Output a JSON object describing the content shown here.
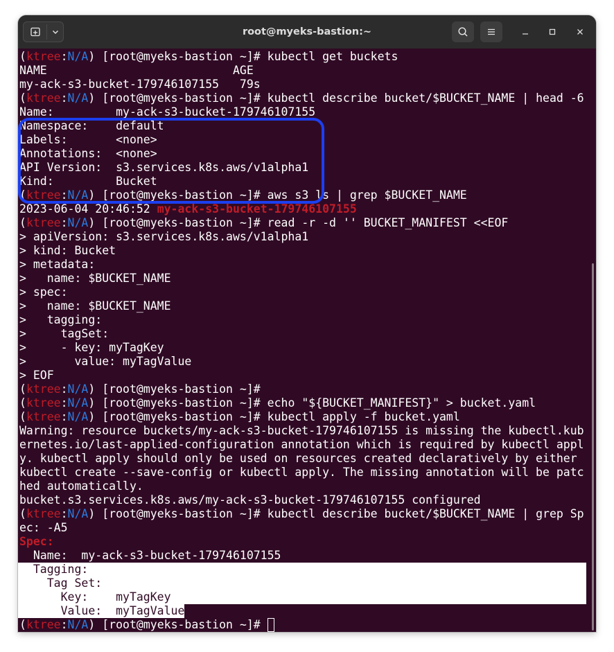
{
  "window": {
    "title": "root@myeks-bastion:~",
    "buttons": {
      "new_tab_icon": "new-tab-icon",
      "dropdown_icon": "chevron-down-icon",
      "search_icon": "search-icon",
      "menu_icon": "hamburger-menu-icon",
      "minimize_icon": "minimize-icon",
      "maximize_icon": "maximize-icon",
      "close_icon": "close-icon"
    }
  },
  "prompt": {
    "open": "(",
    "env": "ktree",
    "sep": ":",
    "ns": "N/A",
    "close": ")",
    "rest": " [root@myeks-bastion ~]# "
  },
  "colors": {
    "background": "#300a24",
    "foreground": "#ffffff",
    "prompt_env": "#c01c28",
    "prompt_ns": "#2a7bde",
    "highlight_box": "#1c3ff0"
  },
  "lines": [
    {
      "type": "prompt",
      "cmd": "kubectl get buckets"
    },
    {
      "type": "text",
      "text": "NAME                           AGE"
    },
    {
      "type": "text",
      "text": "my-ack-s3-bucket-179746107155   79s"
    },
    {
      "type": "prompt",
      "cmd": "kubectl describe bucket/$BUCKET_NAME | head -6"
    },
    {
      "type": "text",
      "text": "Name:         my-ack-s3-bucket-179746107155"
    },
    {
      "type": "text",
      "text": "Namespace:    default"
    },
    {
      "type": "text",
      "text": "Labels:       <none>"
    },
    {
      "type": "text",
      "text": "Annotations:  <none>"
    },
    {
      "type": "text",
      "text": "API Version:  s3.services.k8s.aws/v1alpha1"
    },
    {
      "type": "text",
      "text": "Kind:         Bucket"
    },
    {
      "type": "prompt",
      "cmd": "aws s3 ls | grep $BUCKET_NAME"
    },
    {
      "type": "grep",
      "text": "2023-06-04 20:46:52 ",
      "match": "my-ack-s3-bucket-179746107155"
    },
    {
      "type": "prompt",
      "cmd": "read -r -d '' BUCKET_MANIFEST <<EOF"
    },
    {
      "type": "text",
      "text": "> apiVersion: s3.services.k8s.aws/v1alpha1"
    },
    {
      "type": "text",
      "text": "> kind: Bucket"
    },
    {
      "type": "text",
      "text": "> metadata:"
    },
    {
      "type": "text",
      "text": ">   name: $BUCKET_NAME"
    },
    {
      "type": "text",
      "text": "> spec:"
    },
    {
      "type": "text",
      "text": ">   name: $BUCKET_NAME"
    },
    {
      "type": "text",
      "text": ">   tagging:"
    },
    {
      "type": "text",
      "text": ">     tagSet:"
    },
    {
      "type": "text",
      "text": ">     - key: myTagKey"
    },
    {
      "type": "text",
      "text": ">       value: myTagValue"
    },
    {
      "type": "text",
      "text": "> EOF"
    },
    {
      "type": "prompt",
      "cmd": ""
    },
    {
      "type": "prompt",
      "cmd": "echo \"${BUCKET_MANIFEST}\" > bucket.yaml"
    },
    {
      "type": "prompt",
      "cmd": "kubectl apply -f bucket.yaml"
    },
    {
      "type": "text",
      "text": "Warning: resource buckets/my-ack-s3-bucket-179746107155 is missing the kubectl.kub"
    },
    {
      "type": "text",
      "text": "ernetes.io/last-applied-configuration annotation which is required by kubectl appl"
    },
    {
      "type": "text",
      "text": "y. kubectl apply should only be used on resources created declaratively by either"
    },
    {
      "type": "text",
      "text": "kubectl create --save-config or kubectl apply. The missing annotation will be patc"
    },
    {
      "type": "text",
      "text": "hed automatically."
    },
    {
      "type": "text",
      "text": "bucket.s3.services.k8s.aws/my-ack-s3-bucket-179746107155 configured"
    },
    {
      "type": "prompt",
      "cmd": "kubectl describe bucket/$BUCKET_NAME | grep Sp"
    },
    {
      "type": "text",
      "text": "ec: -A5"
    },
    {
      "type": "bold_red",
      "text": "Spec:"
    },
    {
      "type": "text",
      "text": "  Name:  my-ack-s3-bucket-179746107155"
    },
    {
      "type": "selected",
      "text": "  Tagging:"
    },
    {
      "type": "selected",
      "text": "    Tag Set:"
    },
    {
      "type": "selected",
      "text": "      Key:    myTagKey"
    },
    {
      "type": "selected",
      "text": "      Value:  myTagValue"
    },
    {
      "type": "prompt",
      "cmd": ""
    }
  ]
}
